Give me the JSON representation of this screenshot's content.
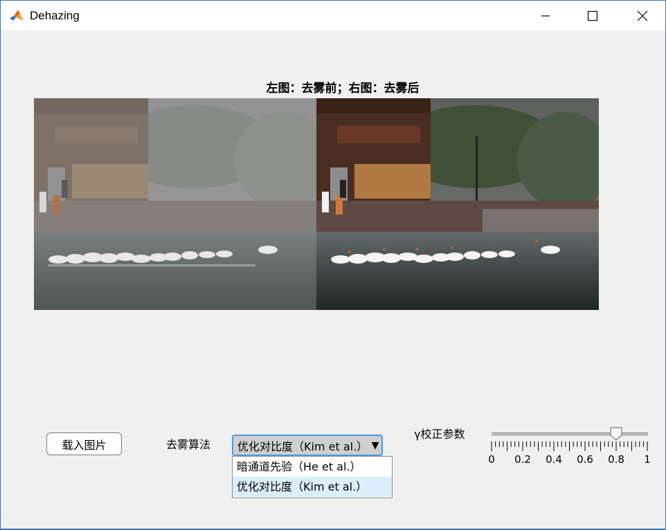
{
  "window": {
    "title": "Dehazing",
    "icon": "matlab-icon",
    "controls": [
      "minimize-icon",
      "maximize-icon",
      "close-icon"
    ]
  },
  "figure": {
    "title": "左图：去雾前；右图：去雾后",
    "images": [
      {
        "name": "before-dehazing-image",
        "description_hidden": true
      },
      {
        "name": "after-dehazing-image",
        "description_hidden": true
      }
    ]
  },
  "controls": {
    "load_button": "载入图片",
    "algorithm_label": "去雾算法",
    "algorithm_selected": "优化对比度（Kim et al.）",
    "algorithm_options": [
      "暗通道先验（He et al.）",
      "优化对比度（Kim et al.）"
    ],
    "gamma_label": "γ校正参数",
    "gamma_value": 0.8,
    "gamma_min": 0,
    "gamma_max": 1,
    "gamma_tick_labels": [
      "0",
      "0.2",
      "0.4",
      "0.6",
      "0.8",
      "1"
    ]
  },
  "colors": {
    "dropdown_border": "#4a9be0",
    "selected_option_bg": "#daeefb",
    "window_border": "#3a6fb0"
  }
}
